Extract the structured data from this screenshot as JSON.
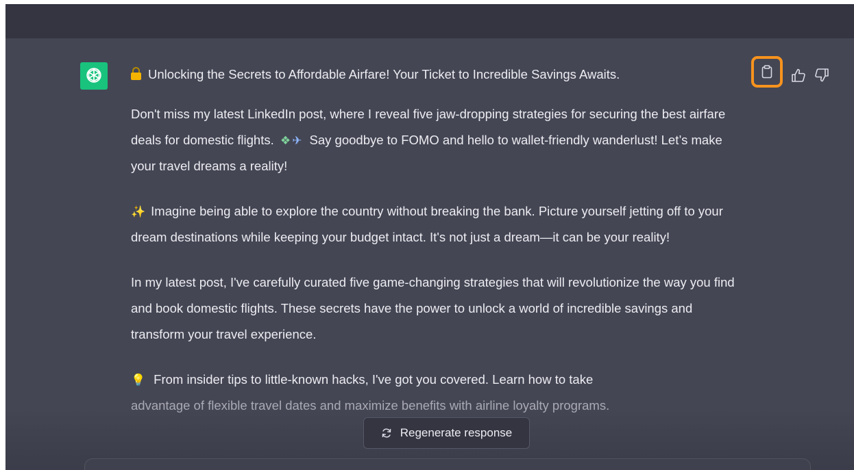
{
  "message": {
    "title": "Unlocking the Secrets to Affordable Airfare! Your Ticket to Incredible Savings Awaits.",
    "p1_part1": "Don't miss my latest LinkedIn post, where I reveal five jaw-dropping strategies for securing the best airfare deals for domestic flights.",
    "p1_part2": "Say goodbye to FOMO and hello to wallet-friendly wanderlust! Let’s make your travel dreams a reality!",
    "p2": "Imagine being able to explore the country without breaking the bank. Picture yourself jetting off to your dream destinations while keeping your budget intact. It's not just a dream—it can be your reality!",
    "p3": "In my latest post, I've carefully curated five game-changing strategies that will revolutionize the way you find and book domestic flights. These secrets have the power to unlock a world of incredible savings and transform your travel experience.",
    "p4_line1": "From insider tips to little-known hacks, I've got you covered. Learn how to take",
    "p4_line2": "advantage of flexible travel dates and maximize benefits with airline loyalty programs."
  },
  "icons": {
    "avatar": "openai-logo-icon",
    "lock": "lock-icon",
    "money": "money-with-wings-icon",
    "plane": "airplane-icon",
    "sparkle": "sparkles-icon",
    "bulb": "light-bulb-icon",
    "copy": "clipboard-icon",
    "thumbs_up": "thumbs-up-icon",
    "thumbs_down": "thumbs-down-icon",
    "regenerate": "refresh-icon"
  },
  "buttons": {
    "regenerate_label": "Regenerate response"
  },
  "colors": {
    "background": "#444654",
    "header": "#343541",
    "avatar": "#19c37d",
    "highlight": "#f7931e",
    "text": "#ececf1"
  }
}
